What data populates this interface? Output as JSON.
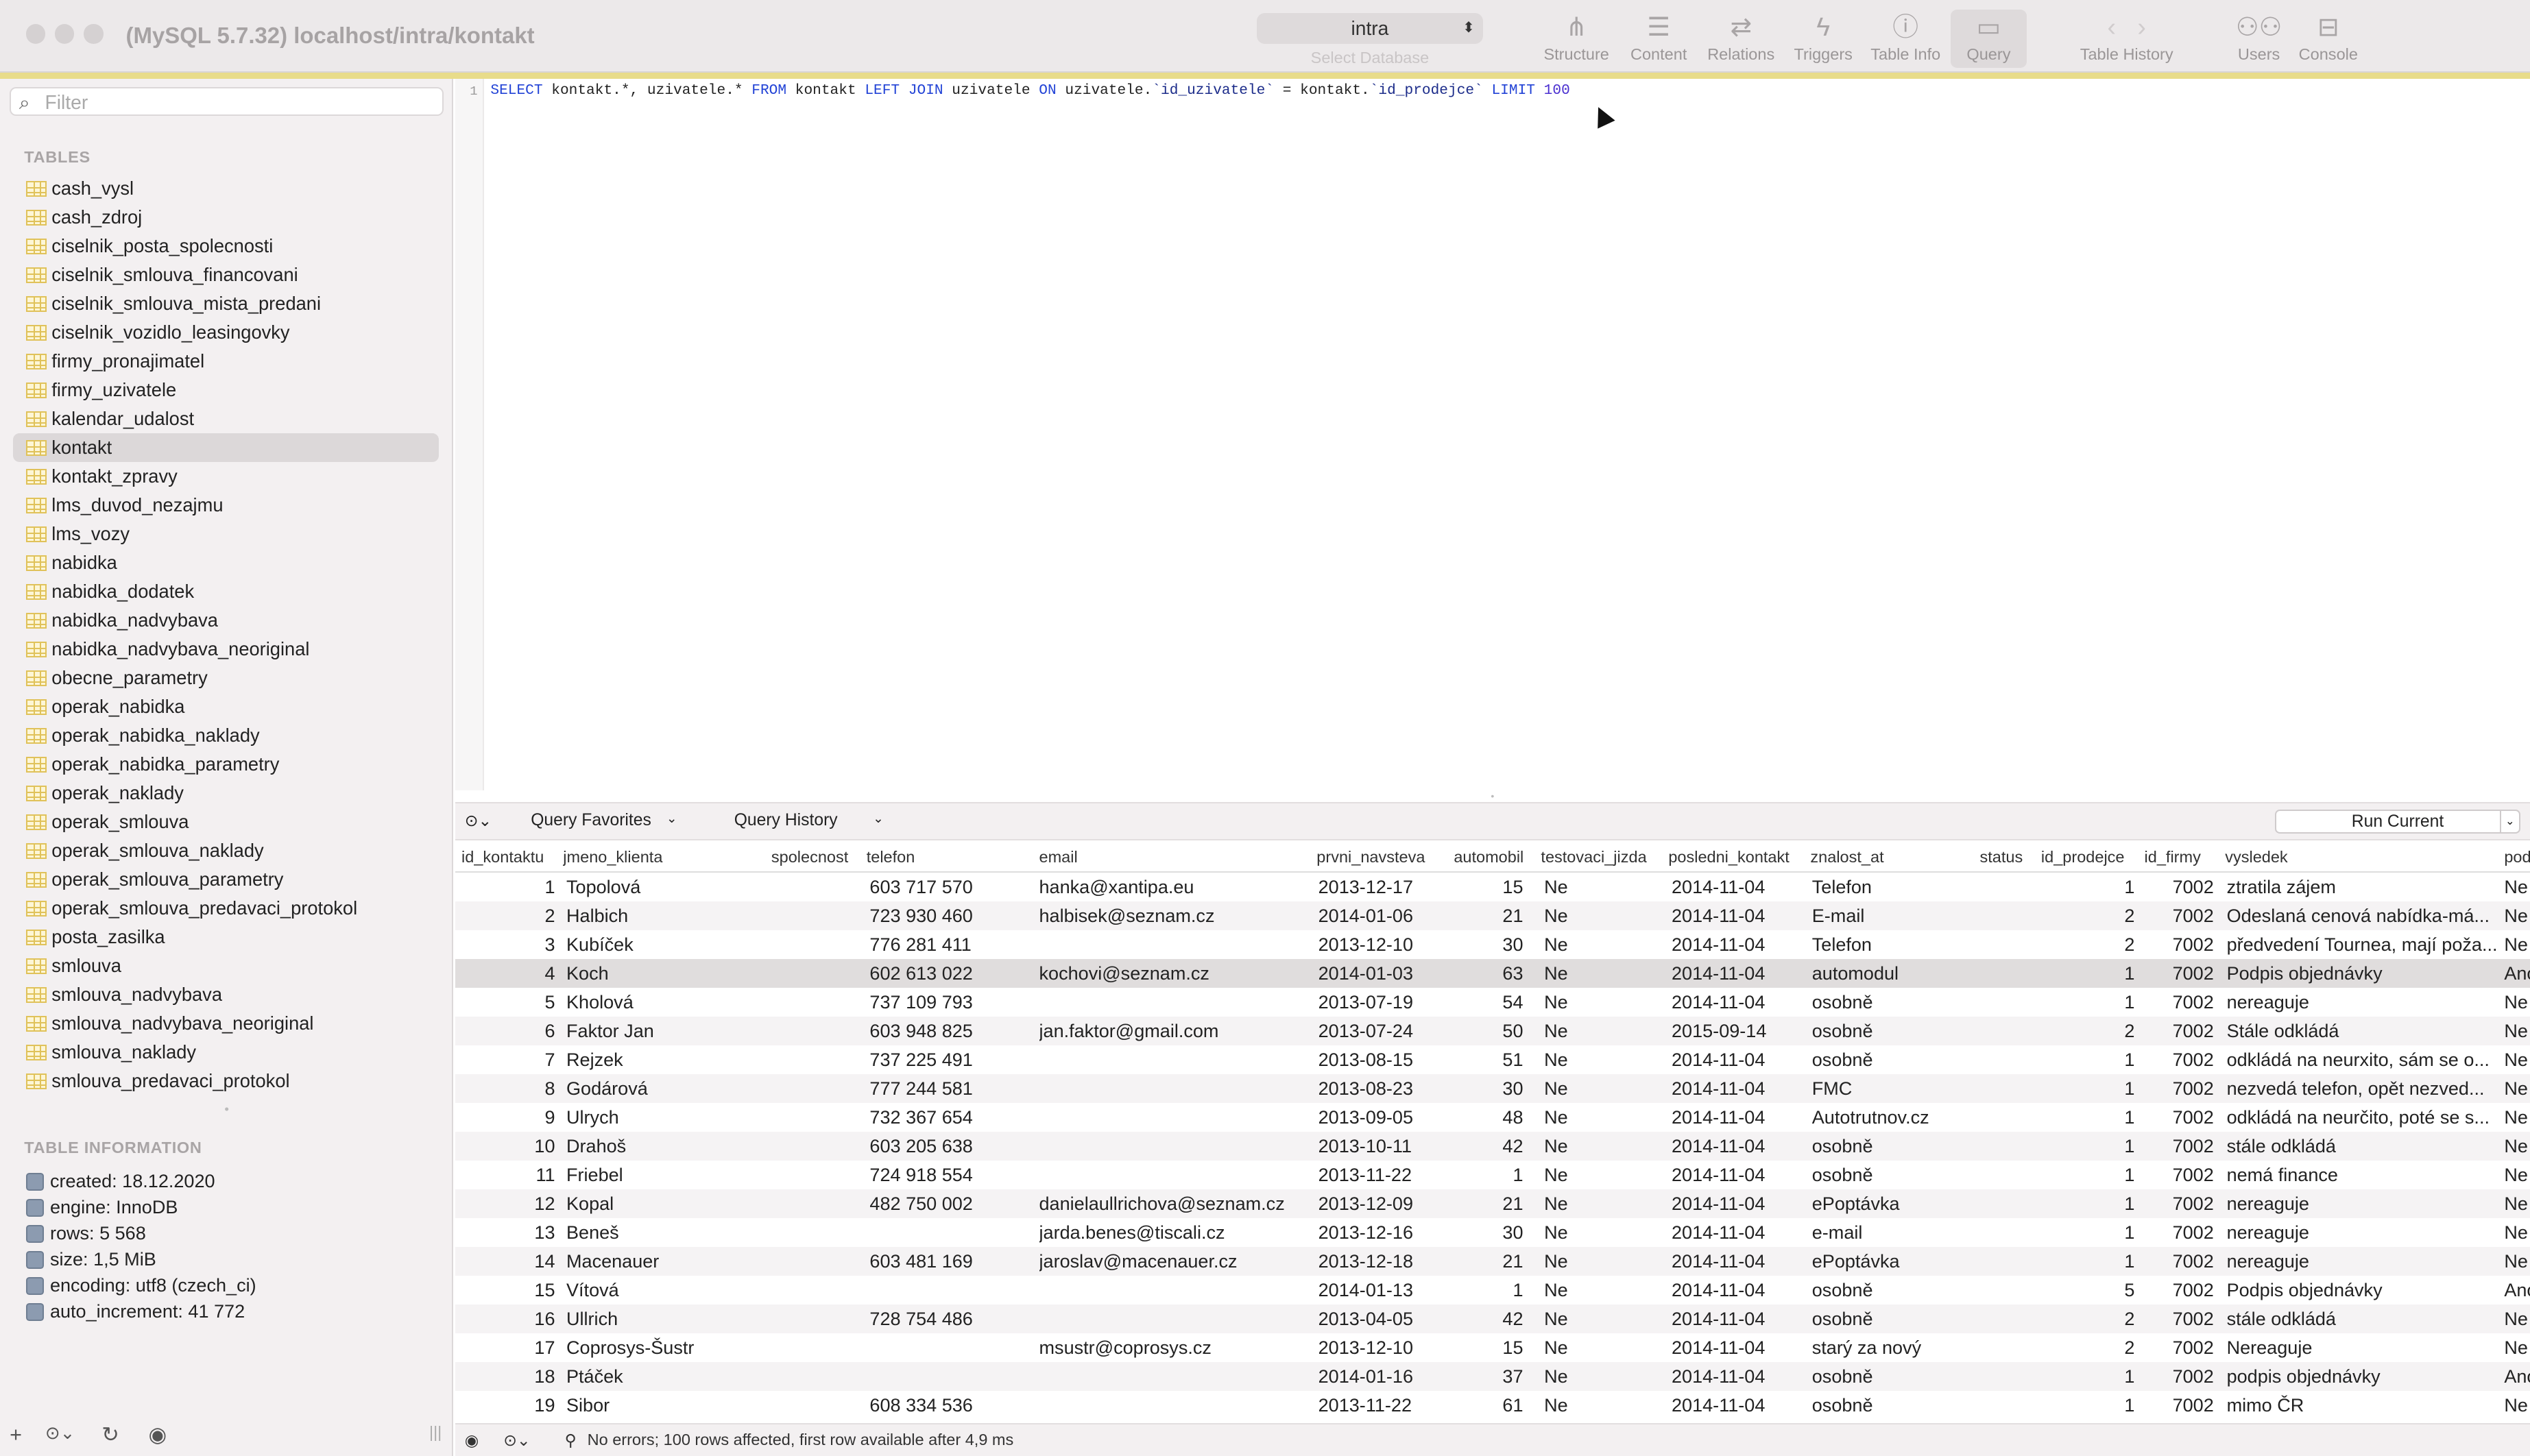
{
  "window": {
    "title": "(MySQL 5.7.32) localhost/intra/kontakt"
  },
  "toolbar": {
    "database": "intra",
    "database_hint": "Select Database",
    "buttons": [
      {
        "label": "Structure",
        "icon": "structure-icon"
      },
      {
        "label": "Content",
        "icon": "content-icon"
      },
      {
        "label": "Relations",
        "icon": "relations-icon"
      },
      {
        "label": "Triggers",
        "icon": "triggers-icon"
      },
      {
        "label": "Table Info",
        "icon": "info-icon"
      },
      {
        "label": "Query",
        "icon": "query-icon"
      },
      {
        "label": "Table History",
        "icon": "history-icon"
      },
      {
        "label": "Users",
        "icon": "users-icon"
      },
      {
        "label": "Console",
        "icon": "console-icon"
      }
    ]
  },
  "sidebar": {
    "filter_placeholder": "Filter",
    "tables_heading": "TABLES",
    "selected": "kontakt",
    "tables": [
      "cash_vysl",
      "cash_zdroj",
      "ciselnik_posta_spolecnosti",
      "ciselnik_smlouva_financovani",
      "ciselnik_smlouva_mista_predani",
      "ciselnik_vozidlo_leasingovky",
      "firmy_pronajimatel",
      "firmy_uzivatele",
      "kalendar_udalost",
      "kontakt",
      "kontakt_zpravy",
      "lms_duvod_nezajmu",
      "lms_vozy",
      "nabidka",
      "nabidka_dodatek",
      "nabidka_nadvybava",
      "nabidka_nadvybava_neoriginal",
      "obecne_parametry",
      "operak_nabidka",
      "operak_nabidka_naklady",
      "operak_nabidka_parametry",
      "operak_naklady",
      "operak_smlouva",
      "operak_smlouva_naklady",
      "operak_smlouva_parametry",
      "operak_smlouva_predavaci_protokol",
      "posta_zasilka",
      "smlouva",
      "smlouva_nadvybava",
      "smlouva_nadvybava_neoriginal",
      "smlouva_naklady",
      "smlouva_predavaci_protokol"
    ],
    "info_heading": "TABLE INFORMATION",
    "info": [
      "created: 18.12.2020",
      "engine: InnoDB",
      "rows: 5 568",
      "size: 1,5 MiB",
      "encoding: utf8 (czech_ci)",
      "auto_increment: 41 772"
    ]
  },
  "editor": {
    "line_number": "1",
    "tokens": [
      {
        "t": "SELECT",
        "k": "kw"
      },
      {
        "t": " kontakt.*, uzivatele.* ",
        "k": ""
      },
      {
        "t": "FROM",
        "k": "kw"
      },
      {
        "t": " kontakt ",
        "k": ""
      },
      {
        "t": "LEFT JOIN",
        "k": "kw"
      },
      {
        "t": " uzivatele ",
        "k": ""
      },
      {
        "t": "ON",
        "k": "kw"
      },
      {
        "t": " uzivatele.",
        "k": ""
      },
      {
        "t": "`id_uzivatele`",
        "k": "str"
      },
      {
        "t": " = kontakt.",
        "k": ""
      },
      {
        "t": "`id_prodejce`",
        "k": "str"
      },
      {
        "t": " ",
        "k": ""
      },
      {
        "t": "LIMIT",
        "k": "kw"
      },
      {
        "t": " ",
        "k": ""
      },
      {
        "t": "100",
        "k": "num"
      }
    ]
  },
  "querybar": {
    "favorites": "Query Favorites",
    "history": "Query History",
    "run": "Run Current"
  },
  "results": {
    "columns": [
      "id_kontaktu",
      "jmeno_klienta",
      "spolecnost",
      "telefon",
      "email",
      "prvni_navsteva",
      "automobil",
      "testovaci_jizda",
      "posledni_kontakt",
      "znalost_at",
      "status",
      "id_prodejce",
      "id_firmy",
      "vysledek",
      "pod"
    ],
    "selected_row": 3,
    "rows": [
      [
        "1",
        "Topolová",
        "",
        "603 717 570",
        "hanka@xantipa.eu",
        "2013-12-17",
        "15",
        "Ne",
        "2014-11-04",
        "Telefon",
        "",
        "1",
        "7002",
        "ztratila zájem",
        "Ne"
      ],
      [
        "2",
        "Halbich",
        "",
        "723 930 460",
        "halbisek@seznam.cz",
        "2014-01-06",
        "21",
        "Ne",
        "2014-11-04",
        "E-mail",
        "",
        "2",
        "7002",
        "Odeslaná cenová nabídka-má...",
        "Ne"
      ],
      [
        "3",
        "Kubíček",
        "",
        "776 281 411",
        "",
        "2013-12-10",
        "30",
        "Ne",
        "2014-11-04",
        "Telefon",
        "",
        "2",
        "7002",
        "předvedení Tournea, mají poža...",
        "Ne"
      ],
      [
        "4",
        "Koch",
        "",
        "602 613 022",
        "kochovi@seznam.cz",
        "2014-01-03",
        "63",
        "Ne",
        "2014-11-04",
        "automodul",
        "",
        "1",
        "7002",
        "Podpis objednávky",
        "Ano"
      ],
      [
        "5",
        "Kholová",
        "",
        "737 109 793",
        "",
        "2013-07-19",
        "54",
        "Ne",
        "2014-11-04",
        "osobně",
        "",
        "1",
        "7002",
        "nereaguje",
        "Ne"
      ],
      [
        "6",
        "Faktor Jan",
        "",
        "603 948 825",
        "jan.faktor@gmail.com",
        "2013-07-24",
        "50",
        "Ne",
        "2015-09-14",
        "osobně",
        "",
        "2",
        "7002",
        "Stále odkládá",
        "Ne"
      ],
      [
        "7",
        "Rejzek",
        "",
        "737 225 491",
        "",
        "2013-08-15",
        "51",
        "Ne",
        "2014-11-04",
        "osobně",
        "",
        "1",
        "7002",
        "odkládá na neurxito, sám se o...",
        "Ne"
      ],
      [
        "8",
        "Godárová",
        "",
        "777 244 581",
        "",
        "2013-08-23",
        "30",
        "Ne",
        "2014-11-04",
        "FMC",
        "",
        "1",
        "7002",
        "nezvedá telefon, opět nezved...",
        "Ne"
      ],
      [
        "9",
        "Ulrych",
        "",
        "732 367 654",
        "",
        "2013-09-05",
        "48",
        "Ne",
        "2014-11-04",
        "Autotrutnov.cz",
        "",
        "1",
        "7002",
        "odkládá na neurčito, poté se s...",
        "Ne"
      ],
      [
        "10",
        "Drahoš",
        "",
        "603 205 638",
        "",
        "2013-10-11",
        "42",
        "Ne",
        "2014-11-04",
        "osobně",
        "",
        "1",
        "7002",
        "stále odkládá",
        "Ne"
      ],
      [
        "11",
        "Friebel",
        "",
        "724 918 554",
        "",
        "2013-11-22",
        "1",
        "Ne",
        "2014-11-04",
        "osobně",
        "",
        "1",
        "7002",
        "nemá finance",
        "Ne"
      ],
      [
        "12",
        "Kopal",
        "",
        "482 750 002",
        "danielaullrichova@seznam.cz",
        "2013-12-09",
        "21",
        "Ne",
        "2014-11-04",
        "ePoptávka",
        "",
        "1",
        "7002",
        "nereaguje",
        "Ne"
      ],
      [
        "13",
        "Beneš",
        "",
        "",
        "jarda.benes@tiscali.cz",
        "2013-12-16",
        "30",
        "Ne",
        "2014-11-04",
        "e-mail",
        "",
        "1",
        "7002",
        "nereaguje",
        "Ne"
      ],
      [
        "14",
        "Macenauer",
        "",
        "603 481 169",
        "jaroslav@macenauer.cz",
        "2013-12-18",
        "21",
        "Ne",
        "2014-11-04",
        "ePoptávka",
        "",
        "1",
        "7002",
        "nereaguje",
        "Ne"
      ],
      [
        "15",
        "Vítová",
        "",
        "",
        "",
        "2014-01-13",
        "1",
        "Ne",
        "2014-11-04",
        "osobně",
        "",
        "5",
        "7002",
        "Podpis objednávky",
        "Ano"
      ],
      [
        "16",
        "Ullrich",
        "",
        "728 754 486",
        "",
        "2013-04-05",
        "42",
        "Ne",
        "2014-11-04",
        "osobně",
        "",
        "2",
        "7002",
        "stále odkládá",
        "Ne"
      ],
      [
        "17",
        "Coprosys-Šustr",
        "",
        "",
        "msustr@coprosys.cz",
        "2013-12-10",
        "15",
        "Ne",
        "2014-11-04",
        "starý za nový",
        "",
        "2",
        "7002",
        "Nereaguje",
        "Ne"
      ],
      [
        "18",
        "Ptáček",
        "",
        "",
        "",
        "2014-01-16",
        "37",
        "Ne",
        "2014-11-04",
        "osobně",
        "",
        "1",
        "7002",
        "podpis objednávky",
        "Ano"
      ],
      [
        "19",
        "Sibor",
        "",
        "608 334 536",
        "",
        "2013-11-22",
        "61",
        "Ne",
        "2014-11-04",
        "osobně",
        "",
        "1",
        "7002",
        "mimo ČR",
        "Ne"
      ]
    ]
  },
  "status": {
    "message": "No errors; 100 rows affected, first row available after 4,9 ms"
  }
}
